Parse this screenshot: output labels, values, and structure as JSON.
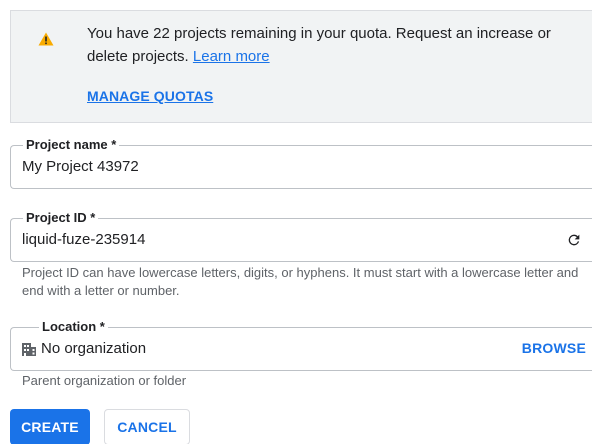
{
  "quota": {
    "message": "You have 22 projects remaining in your quota. Request an increase or delete projects.",
    "learn_more": "Learn more",
    "manage_quotas": "MANAGE QUOTAS"
  },
  "project_name": {
    "label": "Project name  *",
    "value": "My Project 43972"
  },
  "project_id": {
    "label": "Project ID  *",
    "value": "liquid-fuze-235914",
    "helper": "Project ID can have lowercase letters, digits, or hyphens. It must start with a lowercase letter and end with a letter or number."
  },
  "location": {
    "label": "Location *",
    "value": "No organization",
    "browse": "BROWSE",
    "helper": "Parent organization or folder"
  },
  "actions": {
    "create": "CREATE",
    "cancel": "CANCEL"
  },
  "colors": {
    "primary": "#1a73e8",
    "warning": "#f9ab00",
    "banner_bg": "#f1f3f4"
  }
}
